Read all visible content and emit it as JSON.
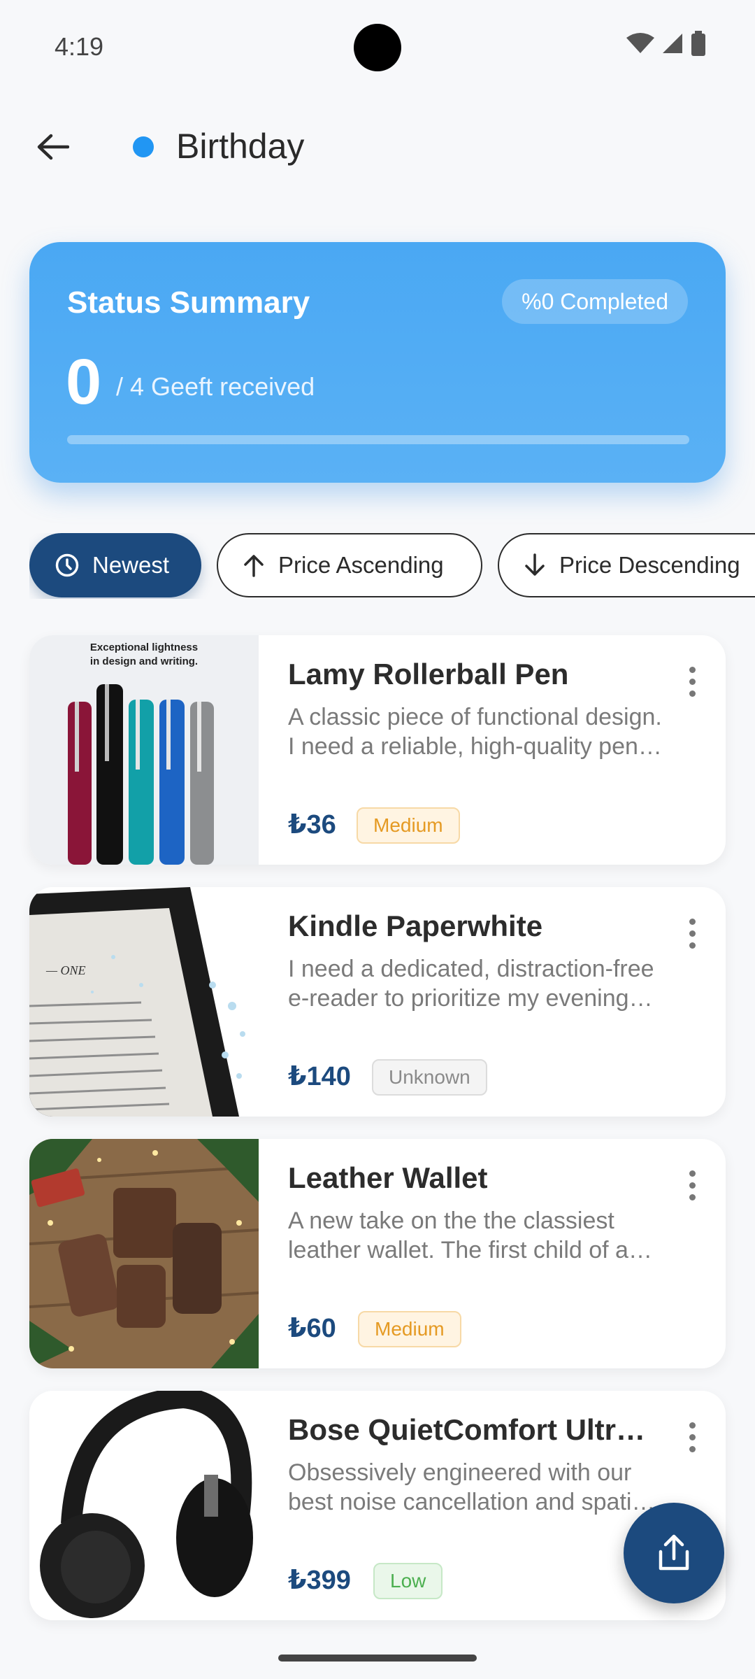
{
  "status_bar": {
    "time": "4:19"
  },
  "header": {
    "title": "Birthday",
    "dot_color": "#2196f3"
  },
  "summary": {
    "title": "Status Summary",
    "completed": "%0 Completed",
    "received_count": "0",
    "received_label": "/ 4 Geeft received",
    "progress": 0
  },
  "sort": {
    "newest": "Newest",
    "price_ascending": "Price Ascending",
    "price_descending": "Price Descending"
  },
  "products": [
    {
      "name": "Lamy Rollerball Pen",
      "description": "A classic piece of functional design. I need a reliable, high-quality pen for everyday writing.",
      "price": "₺36",
      "priority": "Medium",
      "image_caption": "Exceptional lightness in design and writing."
    },
    {
      "name": "Kindle Paperwhite",
      "description": "I need a dedicated, distraction-free e-reader to prioritize my evening reading.",
      "price": "₺140",
      "priority": "Unknown",
      "image_text": "ONE"
    },
    {
      "name": "Leather Wallet",
      "description": "A new take on the the classiest leather wallet. The first child of a new collection.",
      "price": "₺60",
      "priority": "Medium"
    },
    {
      "name": "Bose QuietComfort Ultra Headphones",
      "description": "Obsessively engineered with our best noise cancellation and spatial audio.",
      "price": "₺399",
      "priority": "Low"
    }
  ],
  "colors": {
    "primary": "#1c4a7e",
    "summary_blue": "#4aa8f3",
    "medium": "#e59a23",
    "low": "#4caf50"
  }
}
